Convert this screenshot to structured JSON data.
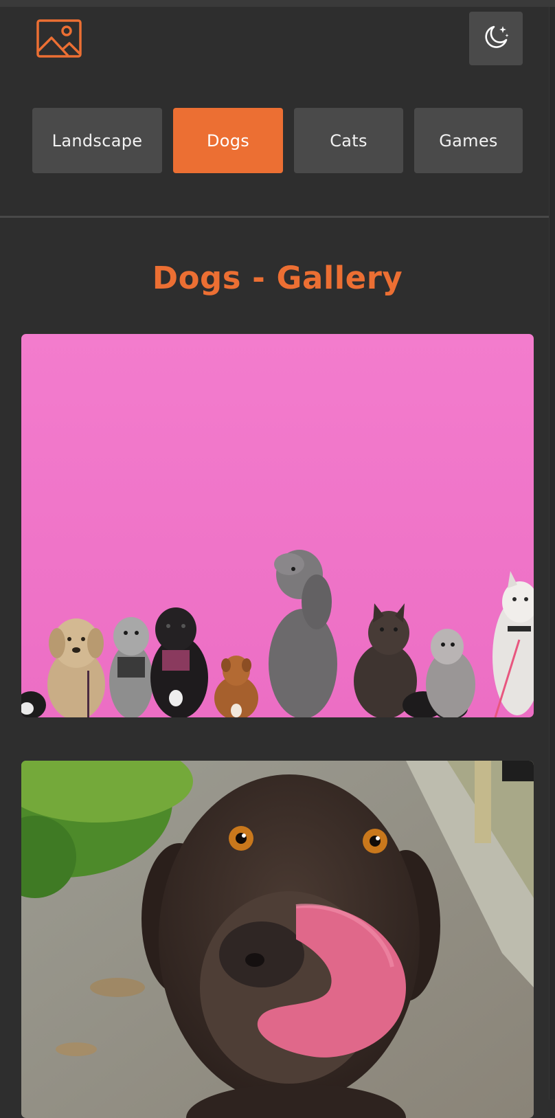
{
  "header": {
    "logo_icon": "image-icon",
    "theme_toggle_icon": "moon-stars-icon"
  },
  "nav": {
    "items": [
      {
        "label": "Landscape",
        "active": false
      },
      {
        "label": "Dogs",
        "active": true
      },
      {
        "label": "Cats",
        "active": false
      },
      {
        "label": "Games",
        "active": false
      }
    ]
  },
  "gallery": {
    "title": "Dogs - Gallery",
    "photos": [
      {
        "subject": "dogs-against-pink-wall-photo"
      },
      {
        "subject": "brown-dog-licking-nose-photo"
      }
    ]
  },
  "colors": {
    "accent": "#ec6f33",
    "background": "#2e2e2e",
    "button": "#4a4a4a",
    "wall_pink": "#f173c9"
  }
}
